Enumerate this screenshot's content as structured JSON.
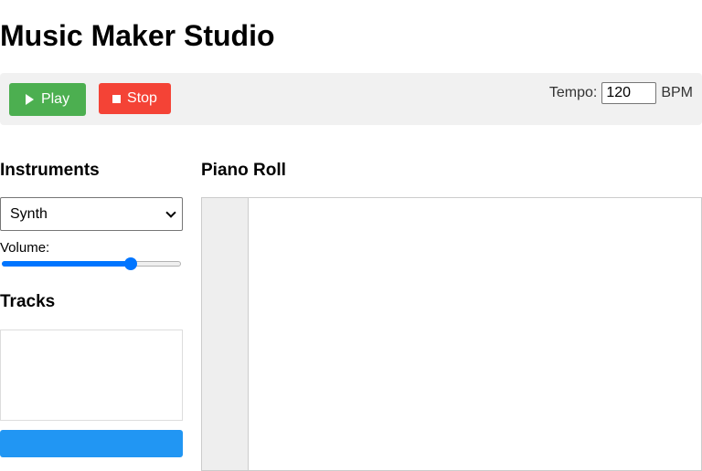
{
  "app": {
    "title": "Music Maker Studio"
  },
  "toolbar": {
    "play_label": "Play",
    "stop_label": "Stop",
    "tempo_label": "Tempo:",
    "tempo_value": "120",
    "tempo_unit": "BPM"
  },
  "instruments": {
    "heading": "Instruments",
    "selected": "Synth",
    "volume_label": "Volume:",
    "volume_level": 0.73
  },
  "tracks": {
    "heading": "Tracks"
  },
  "piano_roll": {
    "heading": "Piano Roll"
  },
  "colors": {
    "play": "#4caf50",
    "stop": "#f44336",
    "accent": "#0075ff",
    "add_track": "#2196f3",
    "toolbar_bg": "#f1f1f1"
  },
  "icons": {
    "play": "play-icon",
    "stop": "stop-icon",
    "dropdown": "chevron-down-icon"
  }
}
